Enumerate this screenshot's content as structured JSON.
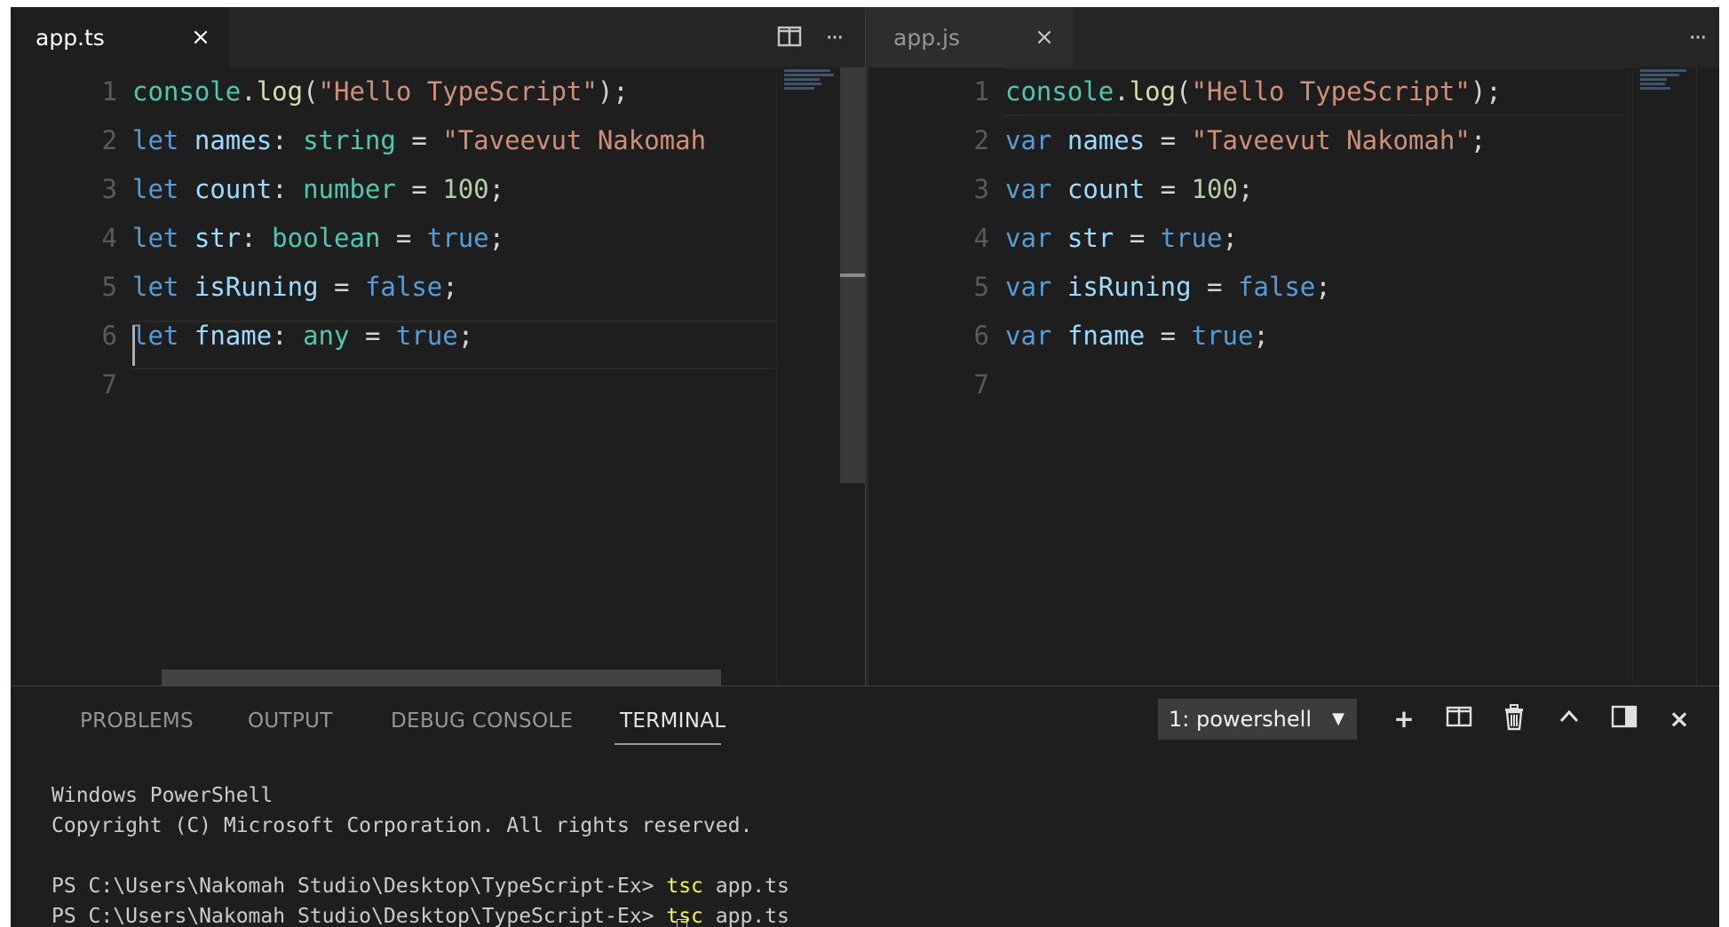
{
  "left_editor": {
    "tab_label": "app.ts",
    "close_glyph": "×",
    "split_icon": "split-editor-icon",
    "more_glyph": "···",
    "lines": [
      {
        "n": "1",
        "tokens": [
          [
            "fn",
            "console"
          ],
          [
            "p",
            "."
          ],
          [
            "call",
            "log"
          ],
          [
            "p",
            "("
          ],
          [
            "str",
            "\"Hello TypeScript\""
          ],
          [
            "p",
            ");"
          ]
        ]
      },
      {
        "n": "2",
        "tokens": [
          [
            "kw",
            "let"
          ],
          [
            "p",
            " "
          ],
          [
            "id",
            "names"
          ],
          [
            "p",
            ": "
          ],
          [
            "type",
            "string"
          ],
          [
            "p",
            " = "
          ],
          [
            "str",
            "\"Taveevut Nakomah"
          ]
        ]
      },
      {
        "n": "3",
        "tokens": [
          [
            "kw",
            "let"
          ],
          [
            "p",
            " "
          ],
          [
            "id",
            "count"
          ],
          [
            "p",
            ": "
          ],
          [
            "type",
            "number"
          ],
          [
            "p",
            " = "
          ],
          [
            "num",
            "100"
          ],
          [
            "p",
            ";"
          ]
        ]
      },
      {
        "n": "4",
        "tokens": [
          [
            "kw",
            "let"
          ],
          [
            "p",
            " "
          ],
          [
            "id",
            "str"
          ],
          [
            "p",
            ": "
          ],
          [
            "type",
            "boolean"
          ],
          [
            "p",
            " = "
          ],
          [
            "kw",
            "true"
          ],
          [
            "p",
            ";"
          ]
        ]
      },
      {
        "n": "5",
        "tokens": [
          [
            "kw",
            "let"
          ],
          [
            "p",
            " "
          ],
          [
            "id",
            "isRuning"
          ],
          [
            "p",
            " = "
          ],
          [
            "kw",
            "false"
          ],
          [
            "p",
            ";"
          ]
        ]
      },
      {
        "n": "6",
        "tokens": [
          [
            "kw",
            "let"
          ],
          [
            "p",
            " "
          ],
          [
            "id",
            "fname"
          ],
          [
            "p",
            ": "
          ],
          [
            "type",
            "any"
          ],
          [
            "p",
            " = "
          ],
          [
            "kw",
            "true"
          ],
          [
            "p",
            ";"
          ]
        ]
      },
      {
        "n": "7",
        "tokens": []
      }
    ]
  },
  "right_editor": {
    "tab_label": "app.js",
    "close_glyph": "×",
    "more_glyph": "···",
    "lines": [
      {
        "n": "1",
        "tokens": [
          [
            "fn",
            "console"
          ],
          [
            "p",
            "."
          ],
          [
            "call",
            "log"
          ],
          [
            "p",
            "("
          ],
          [
            "str",
            "\"Hello TypeScript\""
          ],
          [
            "p",
            ");"
          ]
        ]
      },
      {
        "n": "2",
        "tokens": [
          [
            "kw",
            "var"
          ],
          [
            "p",
            " "
          ],
          [
            "id",
            "names"
          ],
          [
            "p",
            " = "
          ],
          [
            "str",
            "\"Taveevut Nakomah\""
          ],
          [
            "p",
            ";"
          ]
        ]
      },
      {
        "n": "3",
        "tokens": [
          [
            "kw",
            "var"
          ],
          [
            "p",
            " "
          ],
          [
            "id",
            "count"
          ],
          [
            "p",
            " = "
          ],
          [
            "num",
            "100"
          ],
          [
            "p",
            ";"
          ]
        ]
      },
      {
        "n": "4",
        "tokens": [
          [
            "kw",
            "var"
          ],
          [
            "p",
            " "
          ],
          [
            "id",
            "str"
          ],
          [
            "p",
            " = "
          ],
          [
            "kw",
            "true"
          ],
          [
            "p",
            ";"
          ]
        ]
      },
      {
        "n": "5",
        "tokens": [
          [
            "kw",
            "var"
          ],
          [
            "p",
            " "
          ],
          [
            "id",
            "isRuning"
          ],
          [
            "p",
            " = "
          ],
          [
            "kw",
            "false"
          ],
          [
            "p",
            ";"
          ]
        ]
      },
      {
        "n": "6",
        "tokens": [
          [
            "kw",
            "var"
          ],
          [
            "p",
            " "
          ],
          [
            "id",
            "fname"
          ],
          [
            "p",
            " = "
          ],
          [
            "kw",
            "true"
          ],
          [
            "p",
            ";"
          ]
        ]
      },
      {
        "n": "7",
        "tokens": []
      }
    ]
  },
  "panel": {
    "tabs": [
      "PROBLEMS",
      "OUTPUT",
      "DEBUG CONSOLE",
      "TERMINAL"
    ],
    "active_tab": "TERMINAL",
    "terminal_select": "1: powershell",
    "select_arrow": "▼",
    "actions": {
      "new_terminal": "+",
      "split_terminal": "◫",
      "kill_terminal": "🗑",
      "maximize": "^",
      "toggle_panel": "◨",
      "close": "×"
    }
  },
  "terminal": {
    "lines": [
      {
        "text": "Windows PowerShell"
      },
      {
        "text": "Copyright (C) Microsoft Corporation. All rights reserved."
      },
      {
        "text": ""
      },
      {
        "prompt": "PS C:\\Users\\Nakomah Studio\\Desktop\\TypeScript-Ex> ",
        "cmd": "tsc",
        "arg": " app.ts"
      },
      {
        "prompt": "PS C:\\Users\\Nakomah Studio\\Desktop\\TypeScript-Ex> ",
        "cmd": "tsc",
        "arg": " app.ts"
      }
    ]
  },
  "colors": {
    "editor_bg": "#1e1e1e",
    "keyword": "#569cd6",
    "string": "#ce9178",
    "type": "#4ec9b0",
    "number": "#b5cea8",
    "identifier": "#9cdcfe",
    "terminal_cmd": "#f5f543"
  }
}
